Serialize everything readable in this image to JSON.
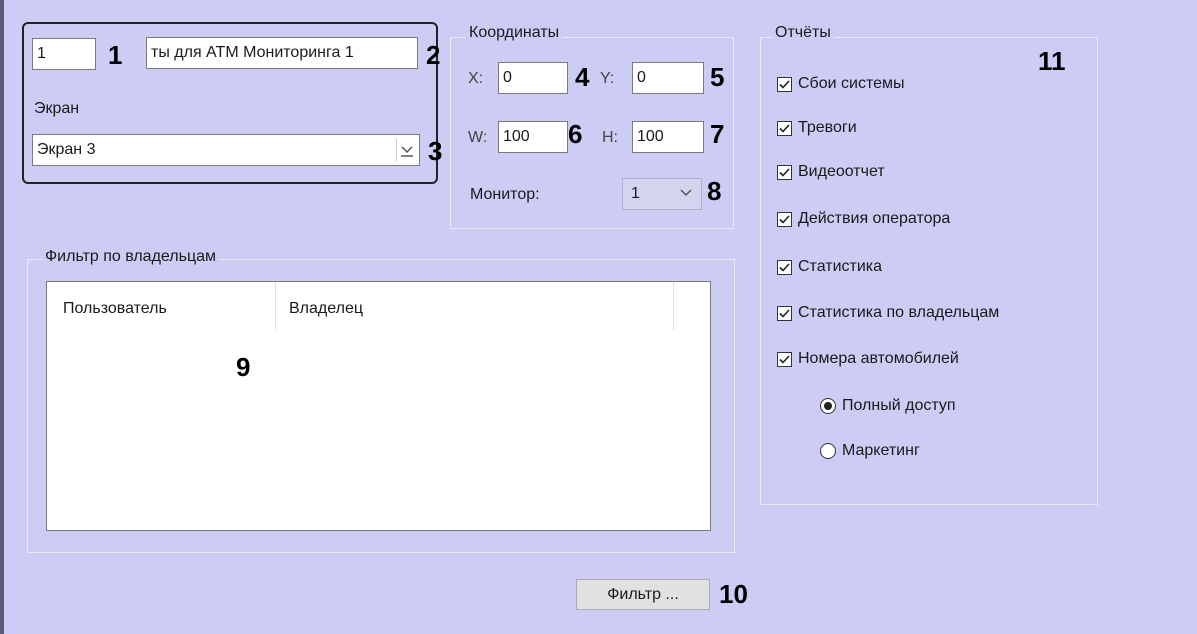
{
  "screen": {
    "id_value": "1",
    "name_value": "ты для ATM Мониторинга 1",
    "screen_label": "Экран",
    "screen_select_value": "Экран 3"
  },
  "coordinates": {
    "title": "Координаты",
    "x_label": "X:",
    "x_value": "0",
    "y_label": "Y:",
    "y_value": "0",
    "w_label": "W:",
    "w_value": "100",
    "h_label": "H:",
    "h_value": "100",
    "monitor_label": "Монитор:",
    "monitor_value": "1"
  },
  "owner_filter": {
    "title": "Фильтр по владельцам",
    "columns": [
      "Пользователь",
      "Владелец"
    ]
  },
  "filter_button": "Фильтр ...",
  "reports": {
    "title": "Отчёты",
    "items": [
      {
        "label": "Сбои системы",
        "checked": true
      },
      {
        "label": "Тревоги",
        "checked": true
      },
      {
        "label": "Видеоотчет",
        "checked": true
      },
      {
        "label": "Действия оператора",
        "checked": true
      },
      {
        "label": "Статистика",
        "checked": true
      },
      {
        "label": "Статистика по владельцам",
        "checked": true
      },
      {
        "label": "Номера автомобилей",
        "checked": true
      }
    ],
    "radios": [
      {
        "label": "Полный доступ",
        "selected": true
      },
      {
        "label": "Маркетинг",
        "selected": false
      }
    ]
  },
  "callouts": [
    "1",
    "2",
    "3",
    "4",
    "5",
    "6",
    "7",
    "8",
    "9",
    "10",
    "11"
  ]
}
